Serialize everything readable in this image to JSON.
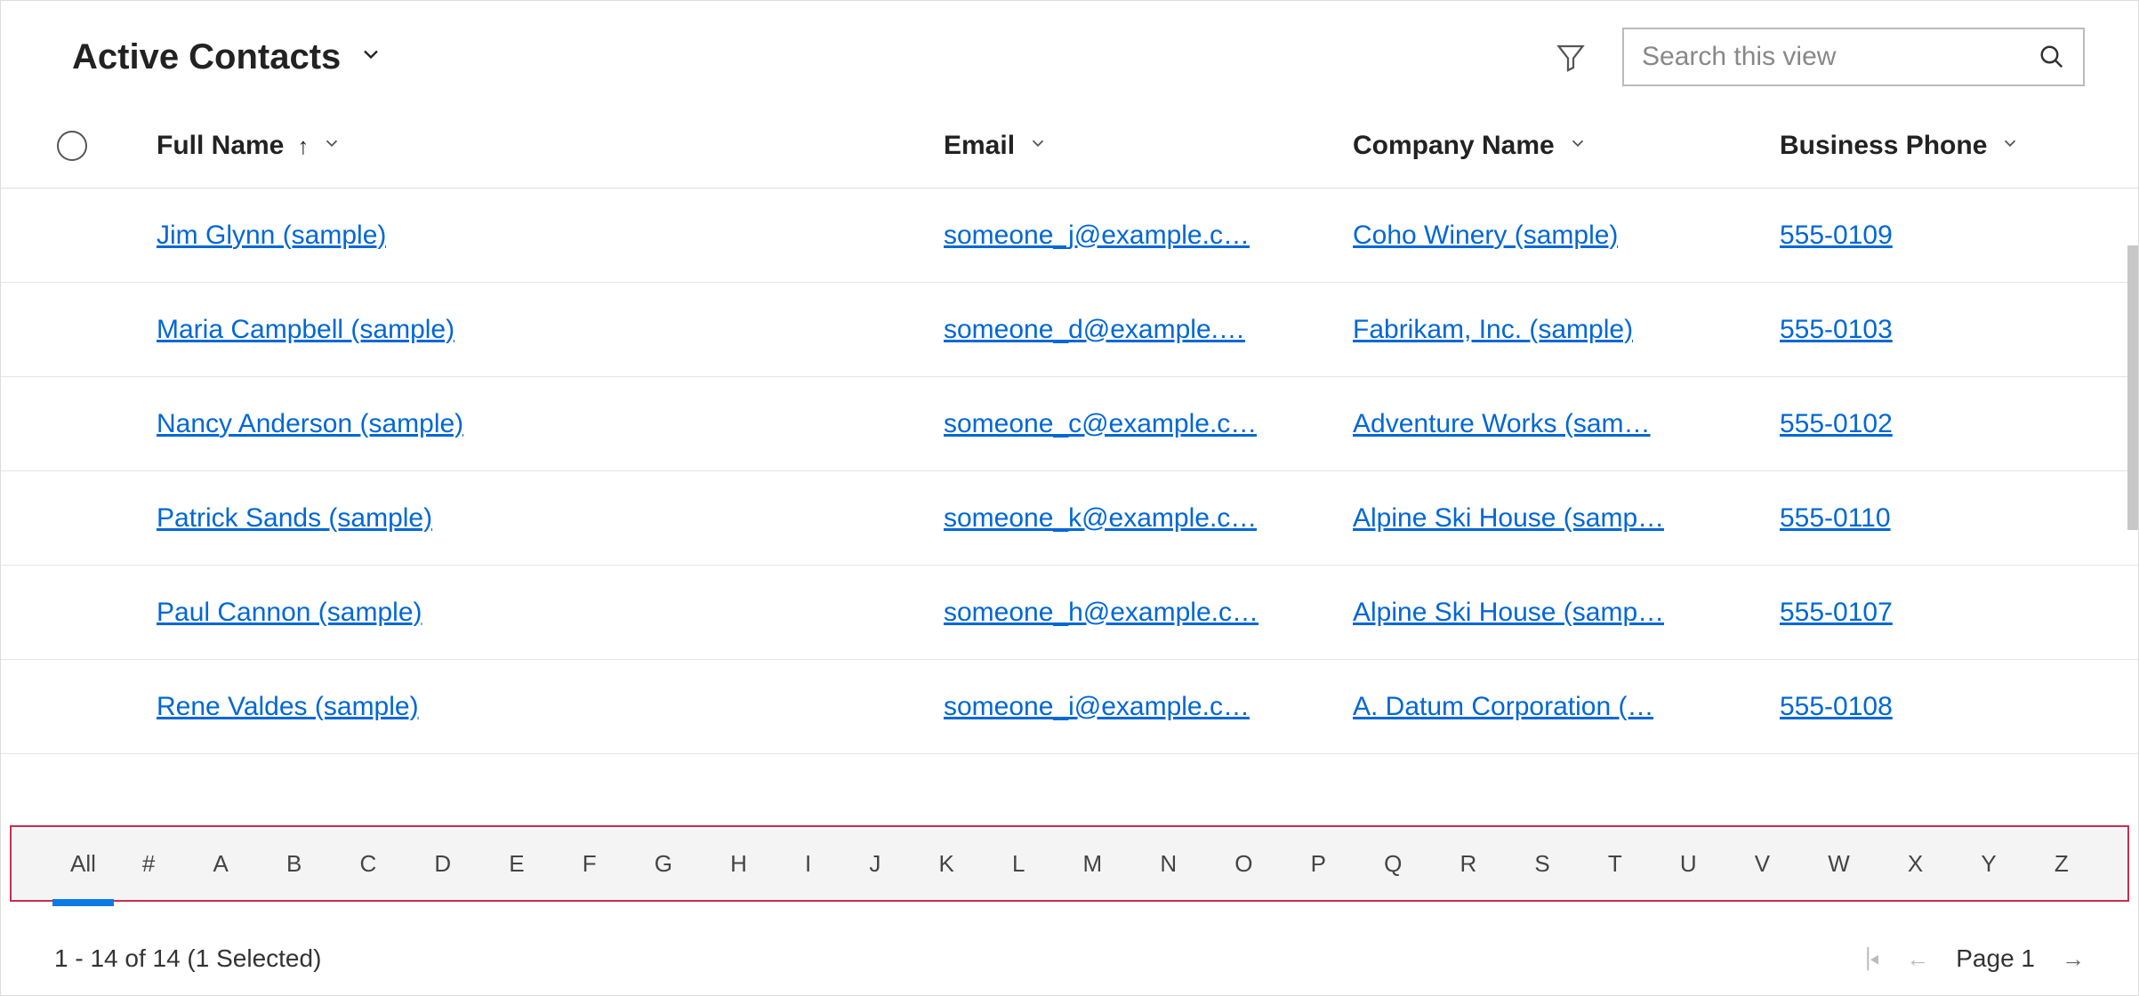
{
  "header": {
    "view_title": "Active Contacts",
    "search_placeholder": "Search this view"
  },
  "columns": {
    "full_name": "Full Name",
    "email": "Email",
    "company": "Company Name",
    "phone": "Business Phone"
  },
  "rows": [
    {
      "name": "Jim Glynn (sample)",
      "email": "someone_j@example.c…",
      "company": "Coho Winery (sample)",
      "phone": "555-0109"
    },
    {
      "name": "Maria Campbell (sample)",
      "email": "someone_d@example.…",
      "company": "Fabrikam, Inc. (sample)",
      "phone": "555-0103"
    },
    {
      "name": "Nancy Anderson (sample)",
      "email": "someone_c@example.c…",
      "company": "Adventure Works (sam…",
      "phone": "555-0102"
    },
    {
      "name": "Patrick Sands (sample)",
      "email": "someone_k@example.c…",
      "company": "Alpine Ski House (samp…",
      "phone": "555-0110"
    },
    {
      "name": "Paul Cannon (sample)",
      "email": "someone_h@example.c…",
      "company": "Alpine Ski House (samp…",
      "phone": "555-0107"
    },
    {
      "name": "Rene Valdes (sample)",
      "email": "someone_i@example.c…",
      "company": "A. Datum Corporation (…",
      "phone": "555-0108"
    }
  ],
  "alpha": {
    "all": "All",
    "letters": [
      "#",
      "A",
      "B",
      "C",
      "D",
      "E",
      "F",
      "G",
      "H",
      "I",
      "J",
      "K",
      "L",
      "M",
      "N",
      "O",
      "P",
      "Q",
      "R",
      "S",
      "T",
      "U",
      "V",
      "W",
      "X",
      "Y",
      "Z"
    ]
  },
  "footer": {
    "status": "1 - 14 of 14 (1 Selected)",
    "page_label": "Page 1"
  }
}
